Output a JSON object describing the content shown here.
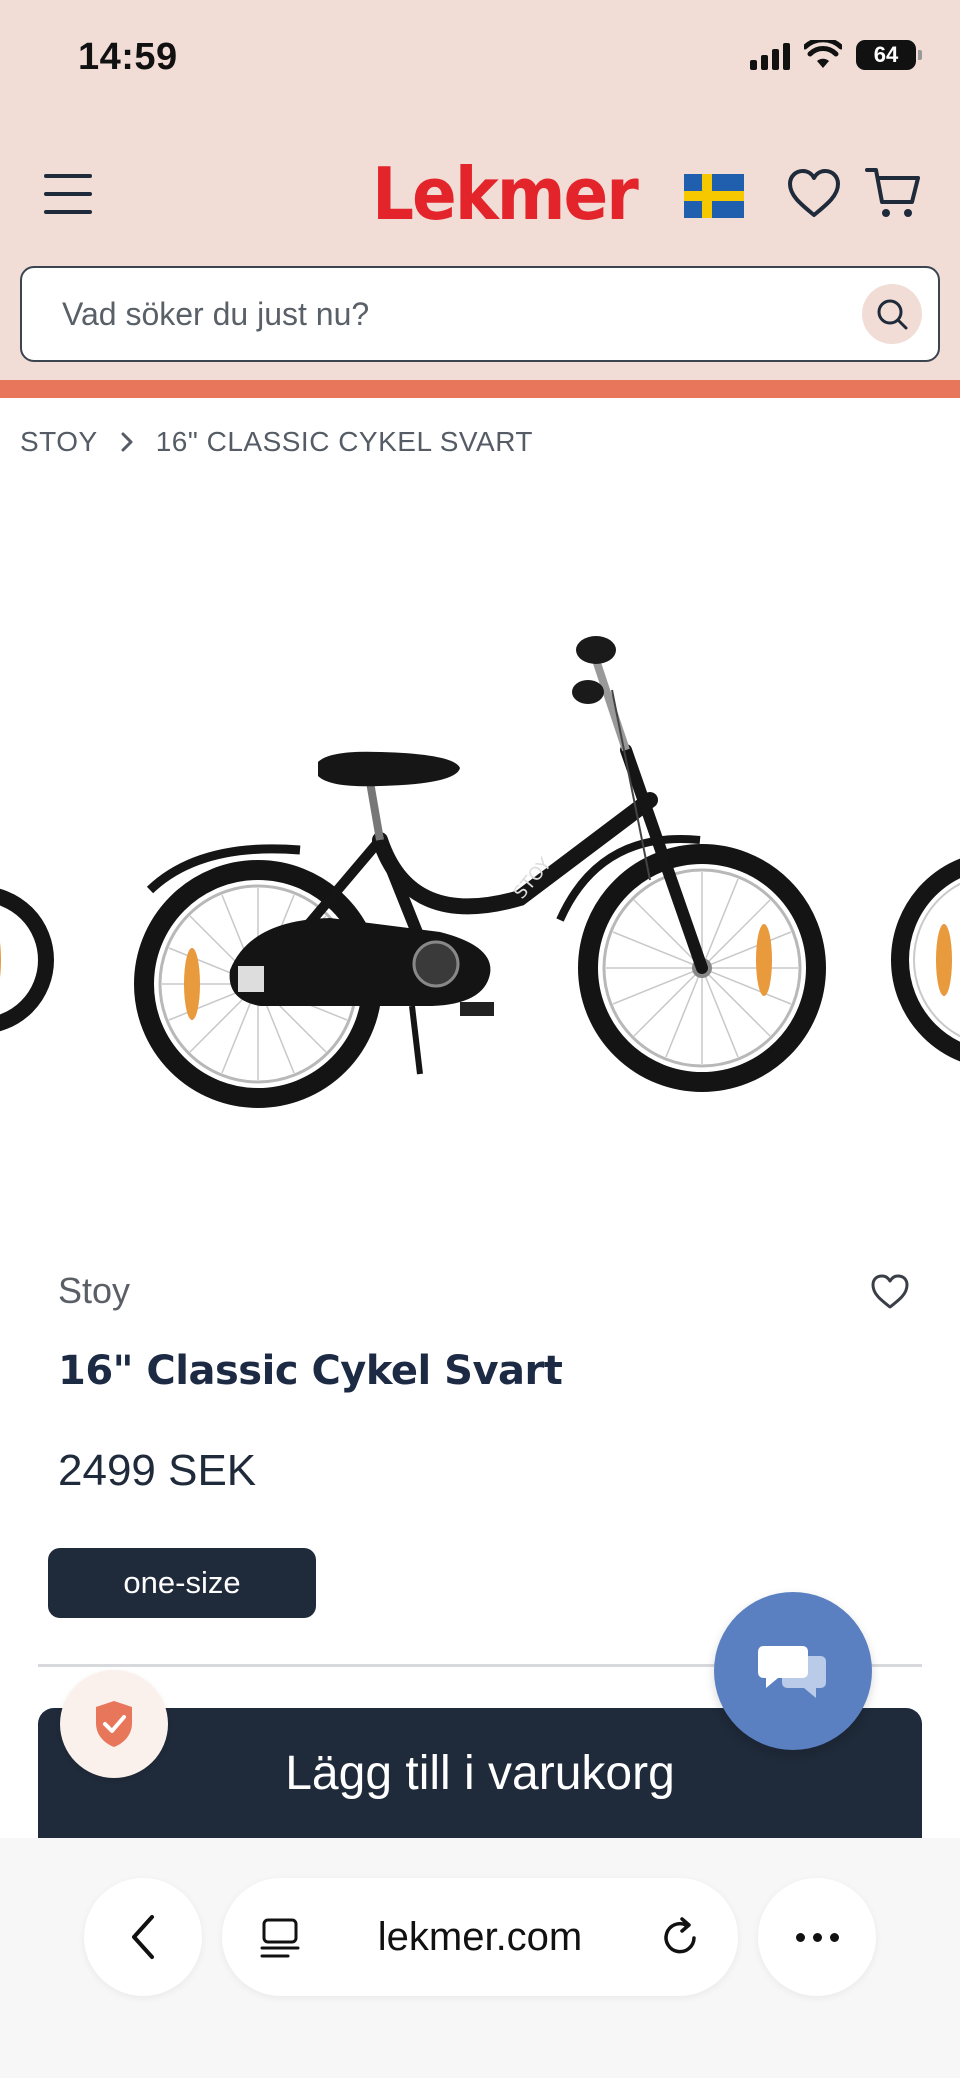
{
  "status_bar": {
    "time": "14:59",
    "battery": "64"
  },
  "header": {
    "logo": "Lekmer"
  },
  "search": {
    "placeholder": "Vad söker du just nu?"
  },
  "breadcrumb": {
    "items": [
      "STOY",
      "16\" CLASSIC CYKEL SVART"
    ]
  },
  "product": {
    "brand": "Stoy",
    "title": "16\" Classic Cykel Svart",
    "price": "2499 SEK",
    "size": "one-size",
    "add_to_cart_label": "Lägg till i varukorg"
  },
  "browser": {
    "url": "lekmer.com"
  },
  "colors": {
    "header_bg": "#f1ddd6",
    "logo_red": "#e3242b",
    "promo_strip": "#e8765b",
    "primary_dark": "#1f2a3a",
    "chat_blue": "#5b80c2",
    "shield_orange": "#e8765b"
  },
  "icons": [
    "menu-icon",
    "sweden-flag-icon",
    "heart-icon",
    "cart-icon",
    "search-icon",
    "chevron-right-icon",
    "chat-icon",
    "shield-check-icon",
    "back-icon",
    "tabs-icon",
    "reload-icon",
    "more-icon"
  ]
}
